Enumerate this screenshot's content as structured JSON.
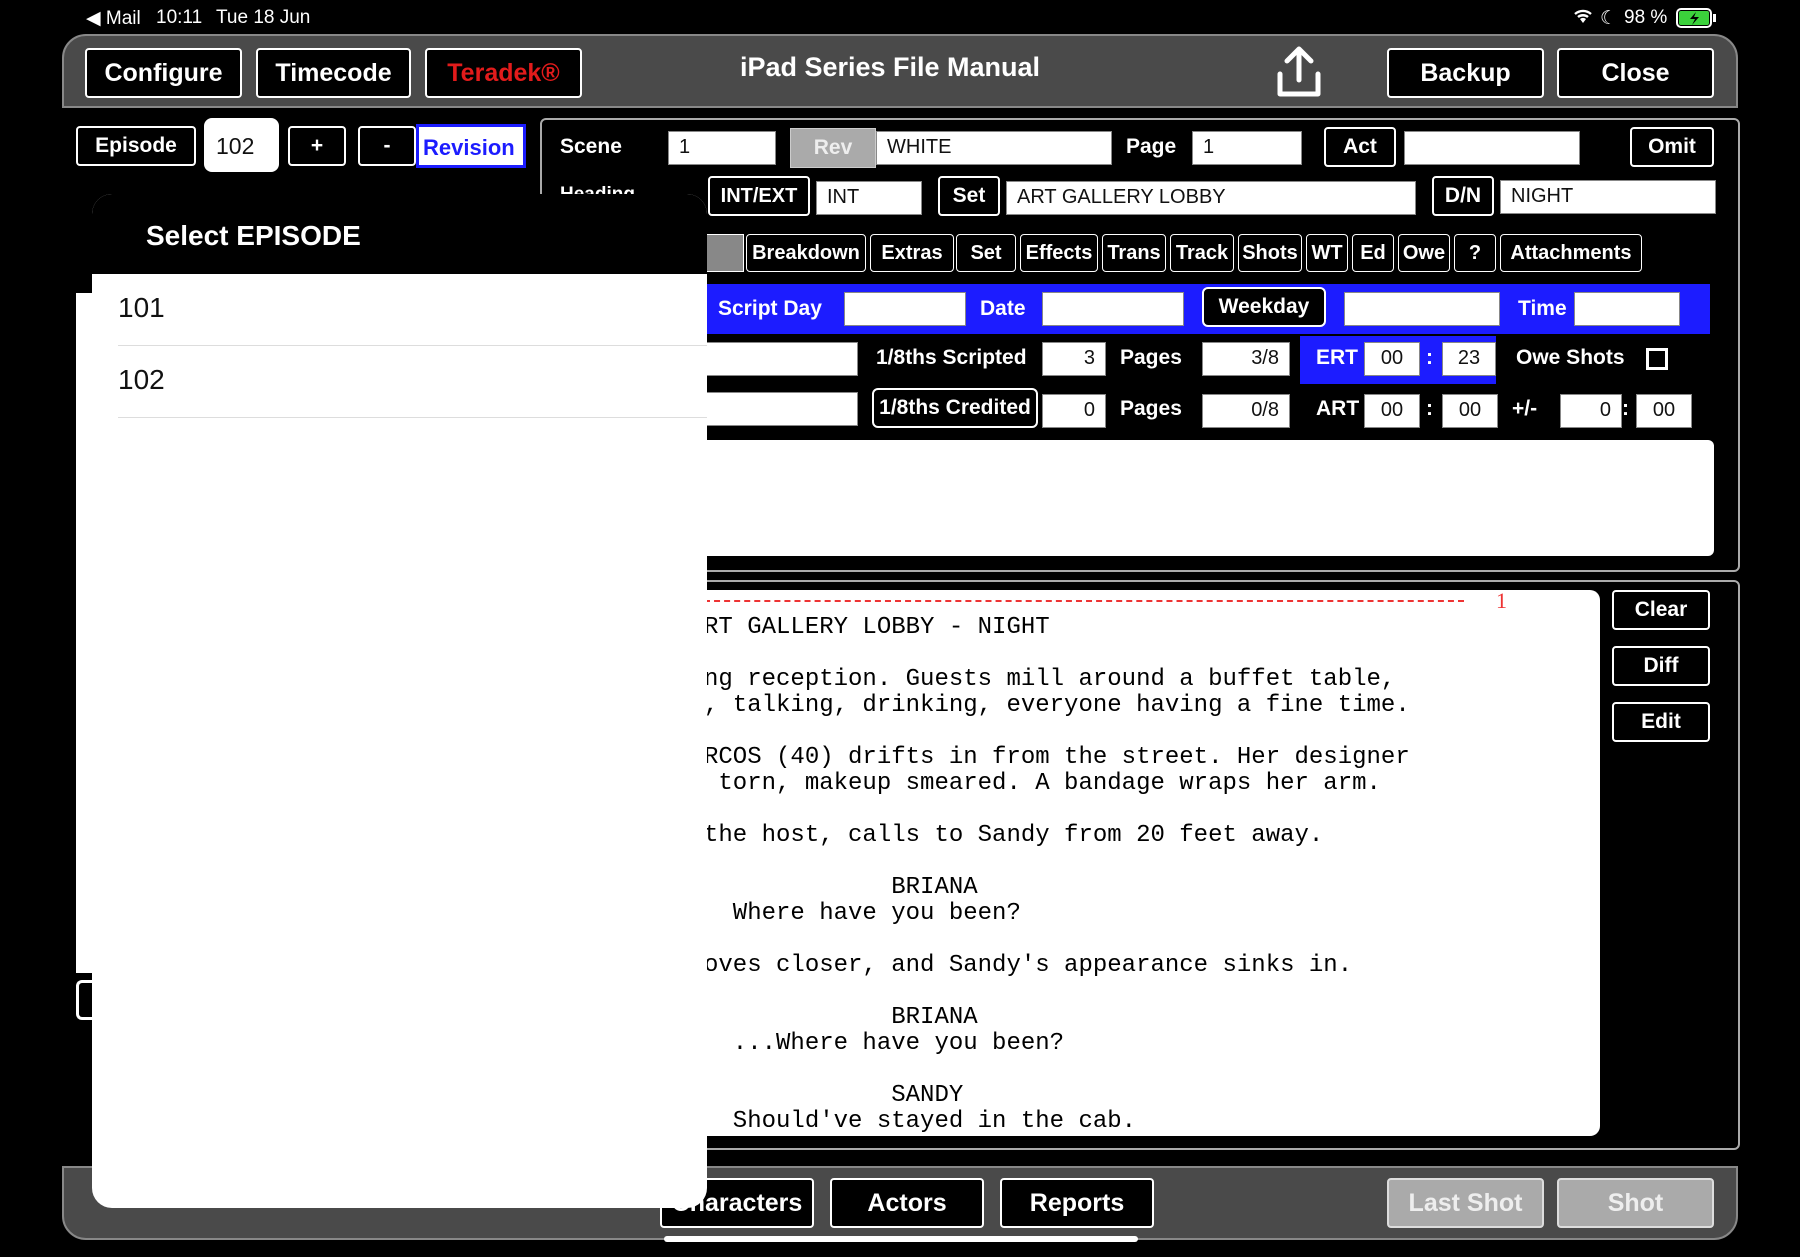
{
  "status_bar": {
    "back_app": "◀ Mail",
    "time": "10:11",
    "date": "Tue 18 Jun",
    "battery": "98 %"
  },
  "header": {
    "configure": "Configure",
    "timecode": "Timecode",
    "teradek": "Teradek®",
    "title": "iPad Series File Manual",
    "backup": "Backup",
    "close": "Close"
  },
  "episode_bar": {
    "episode_label": "Episode",
    "episode_value": "102",
    "plus": "+",
    "minus": "-",
    "revision": "Revision"
  },
  "scene_row": {
    "scene_label": "Scene",
    "scene_value": "1",
    "rev": "Rev",
    "rev_color": "WHITE",
    "page_label": "Page",
    "page_value": "1",
    "act": "Act",
    "act_value": "",
    "omit": "Omit"
  },
  "heading_row": {
    "heading_label": "Heading",
    "int_ext_button": "INT/EXT",
    "int_ext_value": "INT",
    "set_button": "Set",
    "set_value": "ART GALLERY LOBBY",
    "dn_button": "D/N",
    "dn_value": "NIGHT"
  },
  "tabs": [
    "Breakdown",
    "Extras",
    "Set",
    "Effects",
    "Trans",
    "Track",
    "Shots",
    "WT",
    "Ed",
    "Owe",
    "?",
    "Attachments"
  ],
  "day_row": {
    "script_day": "Script Day",
    "date": "Date",
    "weekday": "Weekday",
    "time": "Time"
  },
  "scripted_row": {
    "label": "1/8ths Scripted",
    "value": "3",
    "pages_label": "Pages",
    "pages_value": "3/8",
    "ert_label": "ERT",
    "ert_min": "00",
    "ert_sep": ":",
    "ert_sec": "23",
    "owe_shots": "Owe Shots"
  },
  "credited_row": {
    "label": "1/8ths Credited",
    "value": "0",
    "pages_label": "Pages",
    "pages_value": "0/8",
    "art_label": "ART",
    "art_min": "00",
    "art_sep": ":",
    "art_sec": "00",
    "plusminus_label": "+/-",
    "pm_min": "0",
    "pm_sep": ":",
    "pm_sec": "00"
  },
  "script": {
    "page_number": "1",
    "lines": [
      "RT GALLERY LOBBY - NIGHT",
      "ng reception. Guests mill around a buffet table,",
      ", talking, drinking, everyone having a fine time.",
      "RCOS (40) drifts in from the street. Her designer",
      " torn, makeup smeared. A bandage wraps her arm.",
      "the host, calls to Sandy from 20 feet away.",
      "             BRIANA",
      "  Where have you been?",
      "oves closer, and Sandy's appearance sinks in.",
      "             BRIANA",
      "  ...Where have you been?",
      "             SANDY",
      "  Should've stayed in the cab."
    ]
  },
  "side_buttons": {
    "clear": "Clear",
    "diff": "Diff",
    "edit": "Edit"
  },
  "bottom_bar": {
    "characters": "Characters",
    "actors": "Actors",
    "reports": "Reports",
    "last_shot": "Last Shot",
    "shot": "Shot"
  },
  "popover": {
    "title": "Select EPISODE",
    "items": [
      "101",
      "102"
    ]
  }
}
